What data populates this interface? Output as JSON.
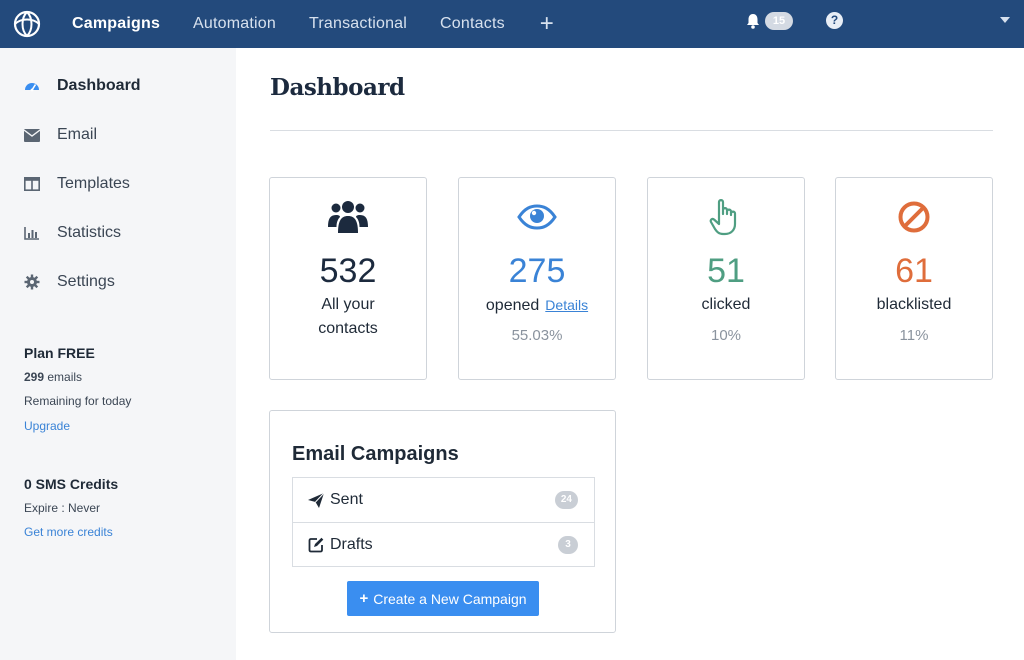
{
  "colors": {
    "topbar": "#234a7c",
    "accent_blue": "#3a8ef0",
    "contacts": "#1c2a3e",
    "opened": "#3a83d6",
    "clicked": "#4f9e82",
    "blacklisted": "#df6d3b"
  },
  "nav": {
    "logo_icon": "sendinblue-logo-icon",
    "items": [
      {
        "label": "Campaigns",
        "active": true
      },
      {
        "label": "Automation"
      },
      {
        "label": "Transactional"
      },
      {
        "label": "Contacts"
      }
    ],
    "plus_label": "+",
    "notifications_count": "15",
    "help_label": "?"
  },
  "sidebar": {
    "items": [
      {
        "label": "Dashboard",
        "icon": "dashboard-gauge-icon",
        "active": true
      },
      {
        "label": "Email",
        "icon": "envelope-icon"
      },
      {
        "label": "Templates",
        "icon": "templates-icon"
      },
      {
        "label": "Statistics",
        "icon": "bar-chart-icon"
      },
      {
        "label": "Settings",
        "icon": "gear-icon"
      }
    ],
    "plan": {
      "title": "Plan FREE",
      "emails_count": "299",
      "emails_label": "emails",
      "remaining": "Remaining for today",
      "upgrade": "Upgrade"
    },
    "sms": {
      "title": "0 SMS Credits",
      "expire": "Expire : Never",
      "more": "Get more credits"
    }
  },
  "main": {
    "title": "Dashboard",
    "stats": {
      "contacts": {
        "value": "532",
        "line1": "All your",
        "line2": "contacts",
        "icon": "users-icon"
      },
      "opened": {
        "value": "275",
        "label": "opened",
        "link": "Details",
        "pct": "55.03%",
        "icon": "eye-icon"
      },
      "clicked": {
        "value": "51",
        "label": "clicked",
        "pct": "10%",
        "icon": "pointer-hand-icon"
      },
      "blacklisted": {
        "value": "61",
        "label": "blacklisted",
        "pct": "11%",
        "icon": "ban-icon"
      }
    },
    "campaigns": {
      "title": "Email Campaigns",
      "rows": [
        {
          "label": "Sent",
          "count": "24",
          "icon": "paper-plane-icon"
        },
        {
          "label": "Drafts",
          "count": "3",
          "icon": "edit-icon"
        }
      ],
      "create_label": "Create a New Campaign"
    }
  }
}
